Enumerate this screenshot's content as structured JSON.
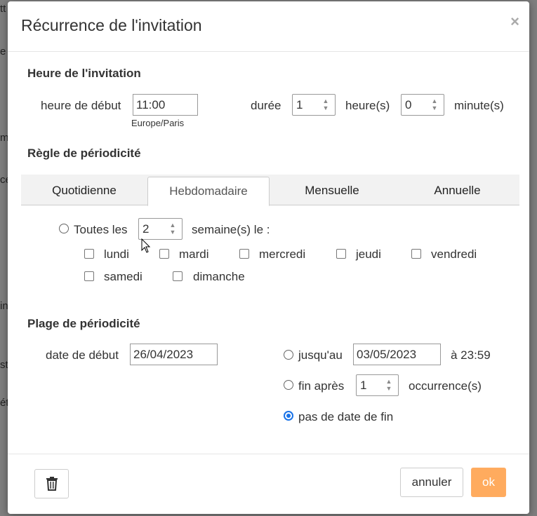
{
  "dialog": {
    "title": "Récurrence de l'invitation",
    "close_glyph": "×"
  },
  "time_section": {
    "heading": "Heure de l'invitation",
    "start_label": "heure de début",
    "start_value": "11:00",
    "timezone": "Europe/Paris",
    "duration_label": "durée",
    "hours_value": "1",
    "hours_unit": "heure(s)",
    "minutes_value": "0",
    "minutes_unit": "minute(s)"
  },
  "rule_section": {
    "heading": "Règle de périodicité",
    "tabs": [
      {
        "label": "Quotidienne",
        "active": false
      },
      {
        "label": "Hebdomadaire",
        "active": true
      },
      {
        "label": "Mensuelle",
        "active": false
      },
      {
        "label": "Annuelle",
        "active": false
      }
    ],
    "every_label": "Toutes les",
    "every_value": "2",
    "weeks_label": "semaine(s) le :",
    "days": [
      {
        "label": "lundi",
        "checked": false
      },
      {
        "label": "mardi",
        "checked": false
      },
      {
        "label": "mercredi",
        "checked": false
      },
      {
        "label": "jeudi",
        "checked": false
      },
      {
        "label": "vendredi",
        "checked": false
      },
      {
        "label": "samedi",
        "checked": false
      },
      {
        "label": "dimanche",
        "checked": false
      }
    ]
  },
  "range_section": {
    "heading": "Plage de périodicité",
    "start_date_label": "date de début",
    "start_date_value": "26/04/2023",
    "until_label": "jusqu'au",
    "until_value": "03/05/2023",
    "until_time": "à 23:59",
    "after_label": "fin après",
    "after_value": "1",
    "occurrences_label": "occurrence(s)",
    "no_end_label": "pas de date de fin",
    "selected": "no_end"
  },
  "footer": {
    "trash_icon": "trash-icon",
    "cancel_label": "annuler",
    "ok_label": "ok"
  },
  "background_fragments": [
    "tt",
    "e",
    "m",
    "ce",
    "in",
    "st",
    "ét"
  ],
  "colors": {
    "accent": "#ffab5e",
    "radio_selected": "#1a73e8",
    "backdrop": "#7f7f7f"
  }
}
